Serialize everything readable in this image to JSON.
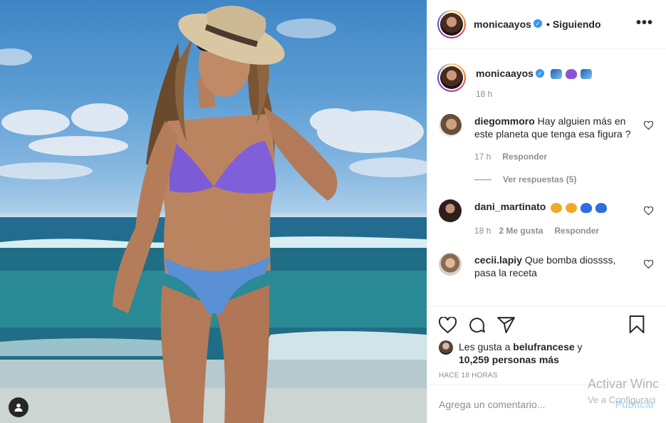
{
  "post": {
    "user_tag_icon": "user-icon"
  },
  "header": {
    "username": "monicaayos",
    "separator": "•",
    "follow_state": "Siguiendo",
    "more_label": "•••"
  },
  "caption": {
    "username": "monicaayos",
    "emojis": [
      "wave",
      "purple-heart",
      "wave"
    ],
    "time": "18 h"
  },
  "comments": [
    {
      "username": "diegommoro",
      "text": "Hay alguien más en este planeta que tenga esa figura ?",
      "time": "17 h",
      "reply_label": "Responder",
      "view_replies": "Ver respuestas (5)"
    },
    {
      "username": "dani_martinato",
      "emojis": [
        "star-struck",
        "star-struck",
        "blue-heart",
        "blue-heart"
      ],
      "time": "18 h",
      "likes": "2 Me gusta",
      "reply_label": "Responder"
    },
    {
      "username": "cecii.lapiy",
      "text": "Que bomba diossss, pasa la receta"
    }
  ],
  "actions": {
    "like_icon": "heart-icon",
    "comment_icon": "comment-icon",
    "share_icon": "paper-plane-icon",
    "save_icon": "bookmark-icon"
  },
  "likes": {
    "prefix": "Les gusta a",
    "liker": "belufrancese",
    "conjunction": "y",
    "others": "10,259 personas más"
  },
  "timestamp": "Hace 18 horas",
  "add_comment": {
    "placeholder": "Agrega un comentario...",
    "publish_label": "Publicar"
  },
  "watermark": {
    "line1": "Activar Winc",
    "line2": "Ve a Configuraci"
  },
  "colors": {
    "verified": "#3897f0",
    "publish_disabled": "#b2dffc",
    "secondary_text": "#8e8e8e"
  }
}
